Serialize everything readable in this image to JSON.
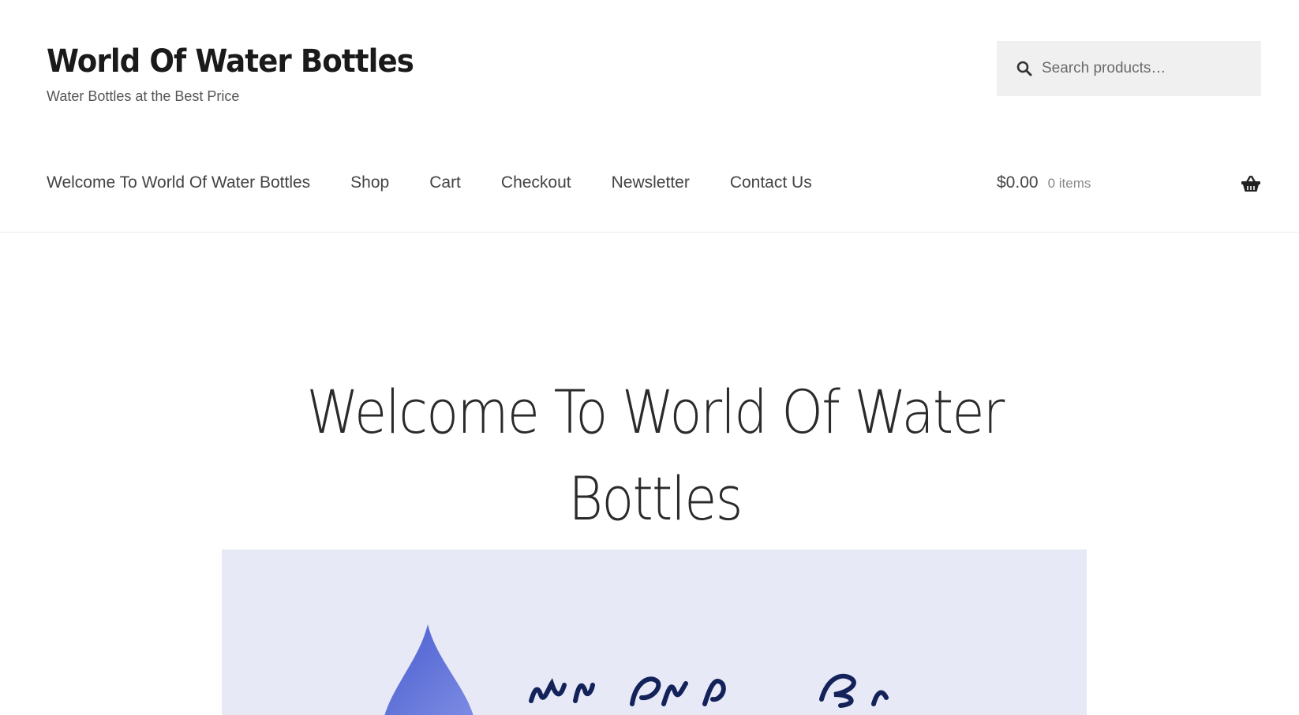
{
  "site": {
    "title": "World Of Water Bottles",
    "tagline": "Water Bottles at the Best Price"
  },
  "search": {
    "icon": "search-icon",
    "placeholder": "Search products…",
    "value": ""
  },
  "nav": {
    "items": [
      {
        "label": "Welcome To World Of Water Bottles"
      },
      {
        "label": "Shop"
      },
      {
        "label": "Cart"
      },
      {
        "label": "Checkout"
      },
      {
        "label": "Newsletter"
      },
      {
        "label": "Contact Us"
      }
    ]
  },
  "cart": {
    "amount": "$0.00",
    "count": "0 items",
    "icon": "basket-icon"
  },
  "page": {
    "title_line1": "Welcome To World Of Water",
    "title_line2": "Bottles"
  },
  "hero": {
    "background": "#e7e9f7",
    "drop_color": "#5a6fd6",
    "script_color": "#14225a"
  },
  "colors": {
    "title": "#1a1a1a",
    "nav_text": "#444444",
    "search_bg": "#f0f0f0"
  }
}
